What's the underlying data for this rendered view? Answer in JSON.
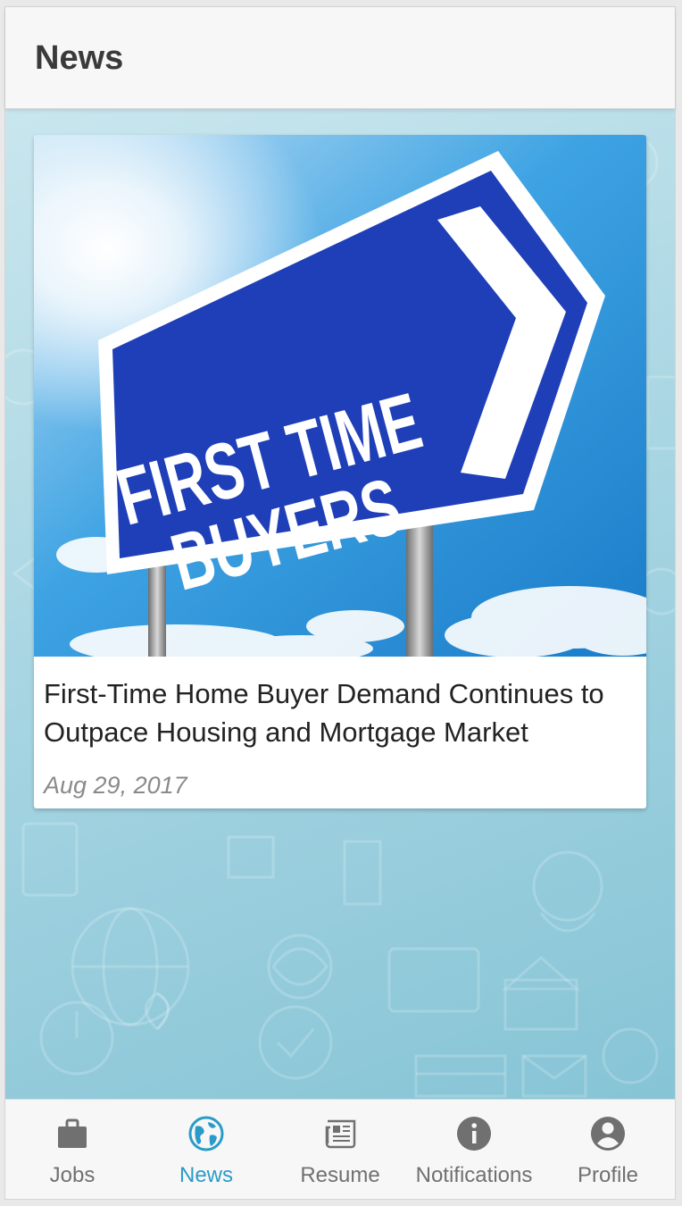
{
  "header": {
    "title": "News"
  },
  "article": {
    "image_sign_line1": "FIRST TIME",
    "image_sign_line2": "BUYERS",
    "title": "First-Time Home Buyer Demand Continues to Outpace Housing and Mortgage Market",
    "date": "Aug 29, 2017"
  },
  "tabs": [
    {
      "label": "Jobs",
      "icon": "briefcase-icon",
      "active": false
    },
    {
      "label": "News",
      "icon": "globe-icon",
      "active": true
    },
    {
      "label": "Resume",
      "icon": "newspaper-icon",
      "active": false
    },
    {
      "label": "Notifications",
      "icon": "info-icon",
      "active": false
    },
    {
      "label": "Profile",
      "icon": "account-circle-icon",
      "active": false
    }
  ],
  "colors": {
    "accent": "#2a9bc9",
    "inactive": "#707070",
    "sign_blue": "#1f3fb8"
  }
}
